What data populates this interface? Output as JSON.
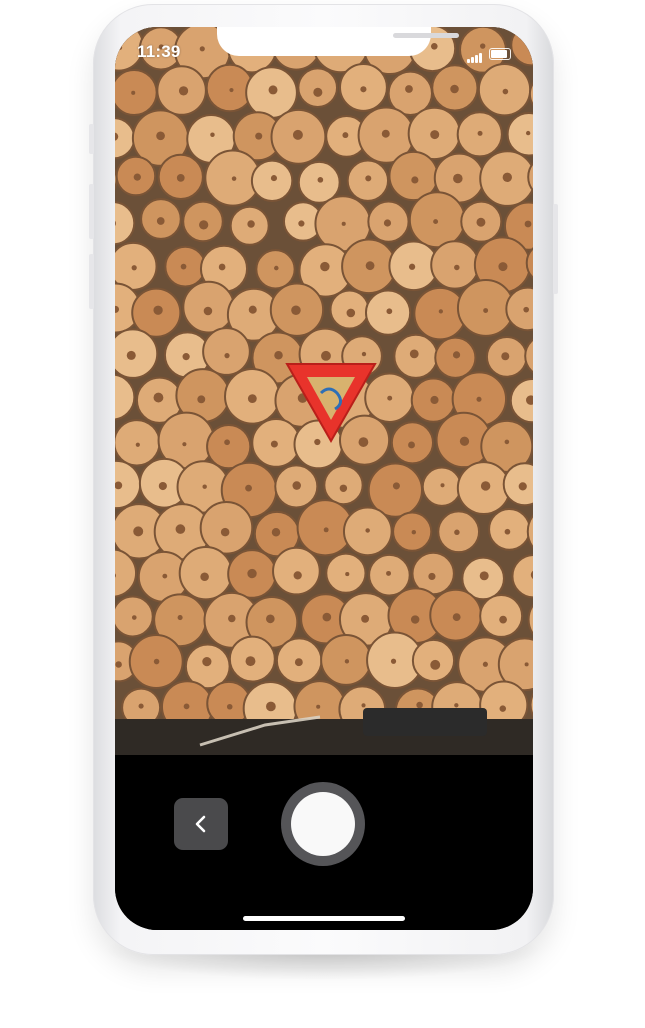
{
  "status_bar": {
    "time": "11:39"
  },
  "camera": {
    "scene": "stacked-log-ends",
    "overlay_marker": "red-triangle-marker"
  },
  "controls": {
    "back_icon": "chevron-left-icon",
    "shutter_icon": "shutter-circle-icon"
  },
  "colors": {
    "controls_background": "#000000",
    "back_button": "#4a4a4c",
    "shutter_ring": "#555558",
    "shutter_fill": "#f9f9f9",
    "marker_red": "#e8332b",
    "device_frame": "#f4f4f6"
  }
}
